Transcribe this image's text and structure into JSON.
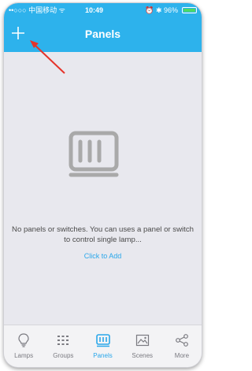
{
  "status_bar": {
    "carrier": "••○○○ 中国移动 ᯤ",
    "time": "10:49",
    "right": "⏰ ✱ 96%",
    "battery_level": 0.96
  },
  "nav": {
    "title": "Panels",
    "add_icon": "plus-icon"
  },
  "empty_state": {
    "icon": "panel-icon",
    "message": "No panels or switches. You can uses a panel or switch to control single lamp...",
    "action": "Click to Add"
  },
  "tabs": [
    {
      "label": "Lamps",
      "icon": "lightbulb-icon",
      "active": false
    },
    {
      "label": "Groups",
      "icon": "grid-icon",
      "active": false
    },
    {
      "label": "Panels",
      "icon": "panel-icon",
      "active": true
    },
    {
      "label": "Scenes",
      "icon": "picture-icon",
      "active": false
    },
    {
      "label": "More",
      "icon": "share-icon",
      "active": false
    }
  ],
  "colors": {
    "primary": "#2db2ec",
    "background": "#e8e8ee",
    "annotation_arrow": "#e5332a",
    "tab_active": "#2aa7ea",
    "tab_inactive": "#7a7a80"
  }
}
